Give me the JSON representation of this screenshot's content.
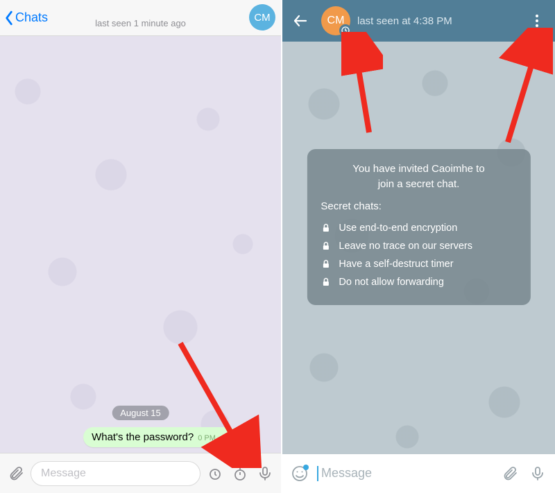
{
  "left": {
    "back_label": "Chats",
    "status": "last seen 1 minute ago",
    "avatar_initials": "CM",
    "date_pill": "August 15",
    "message": {
      "text": "What's the password?",
      "time": "0 PM",
      "checks": "✓✓"
    },
    "input_placeholder": "Message"
  },
  "right": {
    "avatar_initials": "CM",
    "status": "last seen at 4:38 PM",
    "secret_card": {
      "title_line1": "You have invited Caoimhe to",
      "title_line2": "join a secret chat.",
      "subheading": "Secret chats:",
      "items": [
        "Use end-to-end encryption",
        "Leave no trace on our servers",
        "Have a self-destruct timer",
        "Do not allow forwarding"
      ]
    },
    "input_placeholder": "Message"
  }
}
